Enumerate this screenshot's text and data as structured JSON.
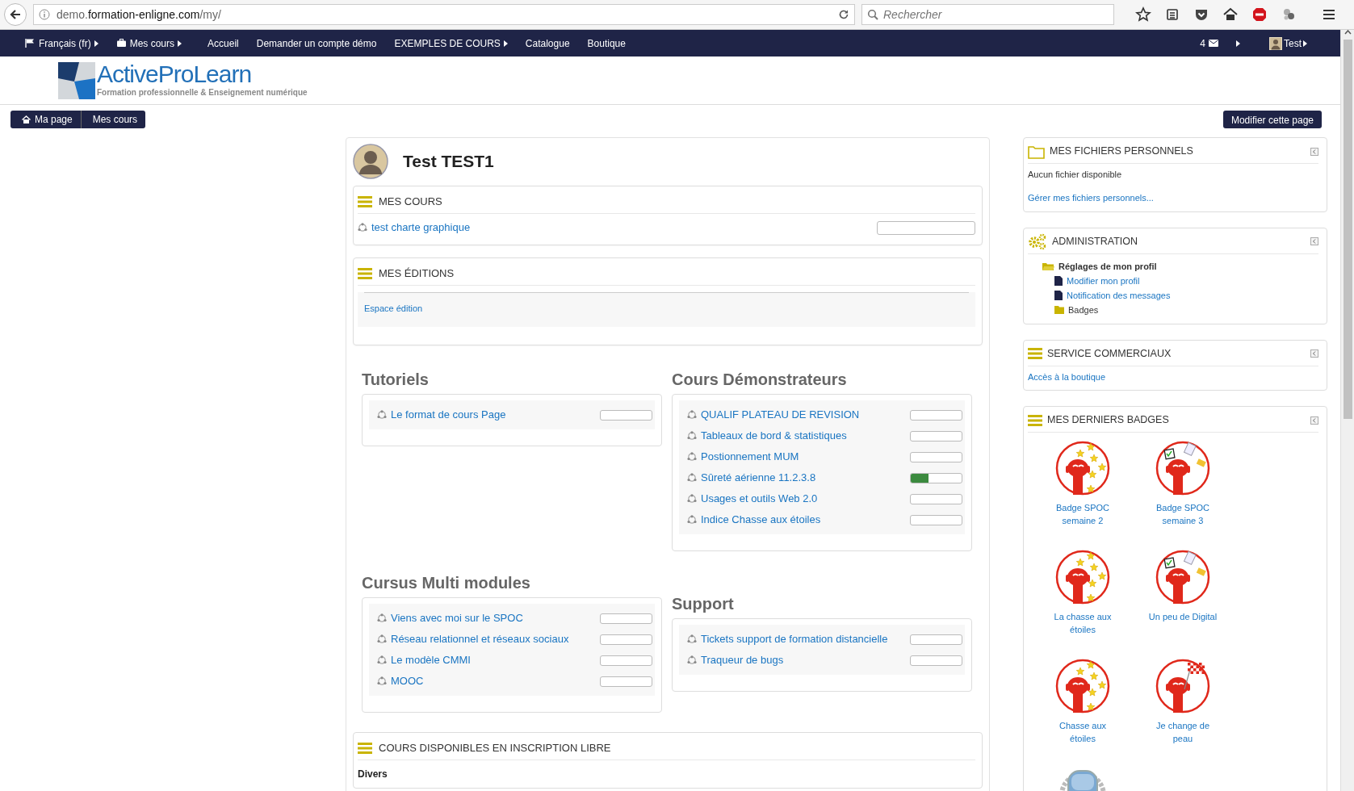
{
  "browser": {
    "url": {
      "subdomain": "demo.",
      "domain": "formation-enligne.com",
      "path": "/my/"
    },
    "search_placeholder": "Rechercher"
  },
  "navbar": {
    "items": [
      {
        "kind": "language",
        "label": "Français (fr)",
        "dropdown": true
      },
      {
        "kind": "courses",
        "label": "Mes cours",
        "dropdown": true
      },
      {
        "kind": "link",
        "label": "Accueil",
        "dropdown": false
      },
      {
        "kind": "link",
        "label": "Demander un compte démo",
        "dropdown": false
      },
      {
        "kind": "link",
        "label": "EXEMPLES DE COURS",
        "dropdown": true
      },
      {
        "kind": "link",
        "label": "Catalogue",
        "dropdown": false
      },
      {
        "kind": "link",
        "label": "Boutique",
        "dropdown": false
      }
    ],
    "messages": {
      "count": "4"
    },
    "user": {
      "label": "Test"
    }
  },
  "logo": {
    "title": "ActiveProLearn",
    "tagline": "Formation professionnelle & Enseignement numérique"
  },
  "breadcrumb": [
    {
      "kind": "home",
      "label": "Ma page"
    },
    {
      "kind": "page",
      "label": "Mes cours"
    }
  ],
  "edit_button": {
    "label": "Modifier cette page"
  },
  "profile": {
    "name": "Test TEST1"
  },
  "main_blocks": [
    {
      "title": "MES COURS",
      "courses": [
        {
          "name": "test charte graphique",
          "level": 0
        }
      ]
    },
    {
      "title": "MES ÉDITIONS",
      "links": [
        "Espace édition"
      ]
    }
  ],
  "course_groups": [
    {
      "title": "Tutoriels",
      "courses": [
        {
          "name": "Le format de cours Page",
          "level": 0
        }
      ]
    },
    {
      "title": "Cours Démonstrateurs",
      "courses": [
        {
          "name": "QUALIF PLATEAU DE REVISION",
          "level": 0
        },
        {
          "name": "Tableaux de bord & statistiques",
          "level": 0
        },
        {
          "name": "Postionnement MUM",
          "level": 0
        },
        {
          "name": "Sûreté aérienne 11.2.3.8",
          "level": 0.35
        },
        {
          "name": "Usages et outils Web 2.0",
          "level": 0
        },
        {
          "name": "Indice Chasse aux étoiles",
          "level": 0
        }
      ]
    },
    {
      "title": "Cursus Multi modules",
      "courses": [
        {
          "name": "Viens avec moi sur le SPOC",
          "level": 0
        },
        {
          "name": "Réseau relationnel et réseaux sociaux",
          "level": 0
        },
        {
          "name": "Le modèle CMMI",
          "level": 0
        },
        {
          "name": "MOOC",
          "level": 0
        }
      ]
    },
    {
      "title": "Support",
      "courses": [
        {
          "name": "Tickets support de formation distancielle",
          "level": 0
        },
        {
          "name": "Traqueur de bugs",
          "level": 0
        }
      ]
    }
  ],
  "bottom_block": {
    "title": "COURS DISPONIBLES EN INSCRIPTION LIBRE",
    "category": "Divers"
  },
  "sidebar": {
    "files": {
      "title": "MES FICHIERS PERSONNELS",
      "empty_text": "Aucun fichier disponible",
      "manage_link": "Gérer mes fichiers personnels..."
    },
    "administration": {
      "title": "ADMINISTRATION",
      "tree": [
        {
          "kind": "folder",
          "label": "Réglages de mon profil",
          "children": [
            {
              "kind": "page",
              "label": "Modifier mon profil"
            },
            {
              "kind": "page",
              "label": "Notification des messages"
            },
            {
              "kind": "category",
              "label": "Badges"
            }
          ]
        }
      ]
    },
    "commercial": {
      "title": "SERVICE COMMERCIAUX",
      "links": [
        "Accès à la boutique"
      ]
    },
    "badges": {
      "title": "MES DERNIERS BADGES",
      "items": [
        {
          "kind": "stars",
          "label": "Badge SPOC semaine 2"
        },
        {
          "kind": "docs",
          "label": "Badge SPOC semaine 3"
        },
        {
          "kind": "stars",
          "label": "La chasse aux étoiles"
        },
        {
          "kind": "docs",
          "label": "Un peu de Digital"
        },
        {
          "kind": "stars",
          "label": "Chasse aux étoiles"
        },
        {
          "kind": "flag",
          "label": "Je change de peau"
        },
        {
          "kind": "laurel"
        }
      ]
    }
  }
}
